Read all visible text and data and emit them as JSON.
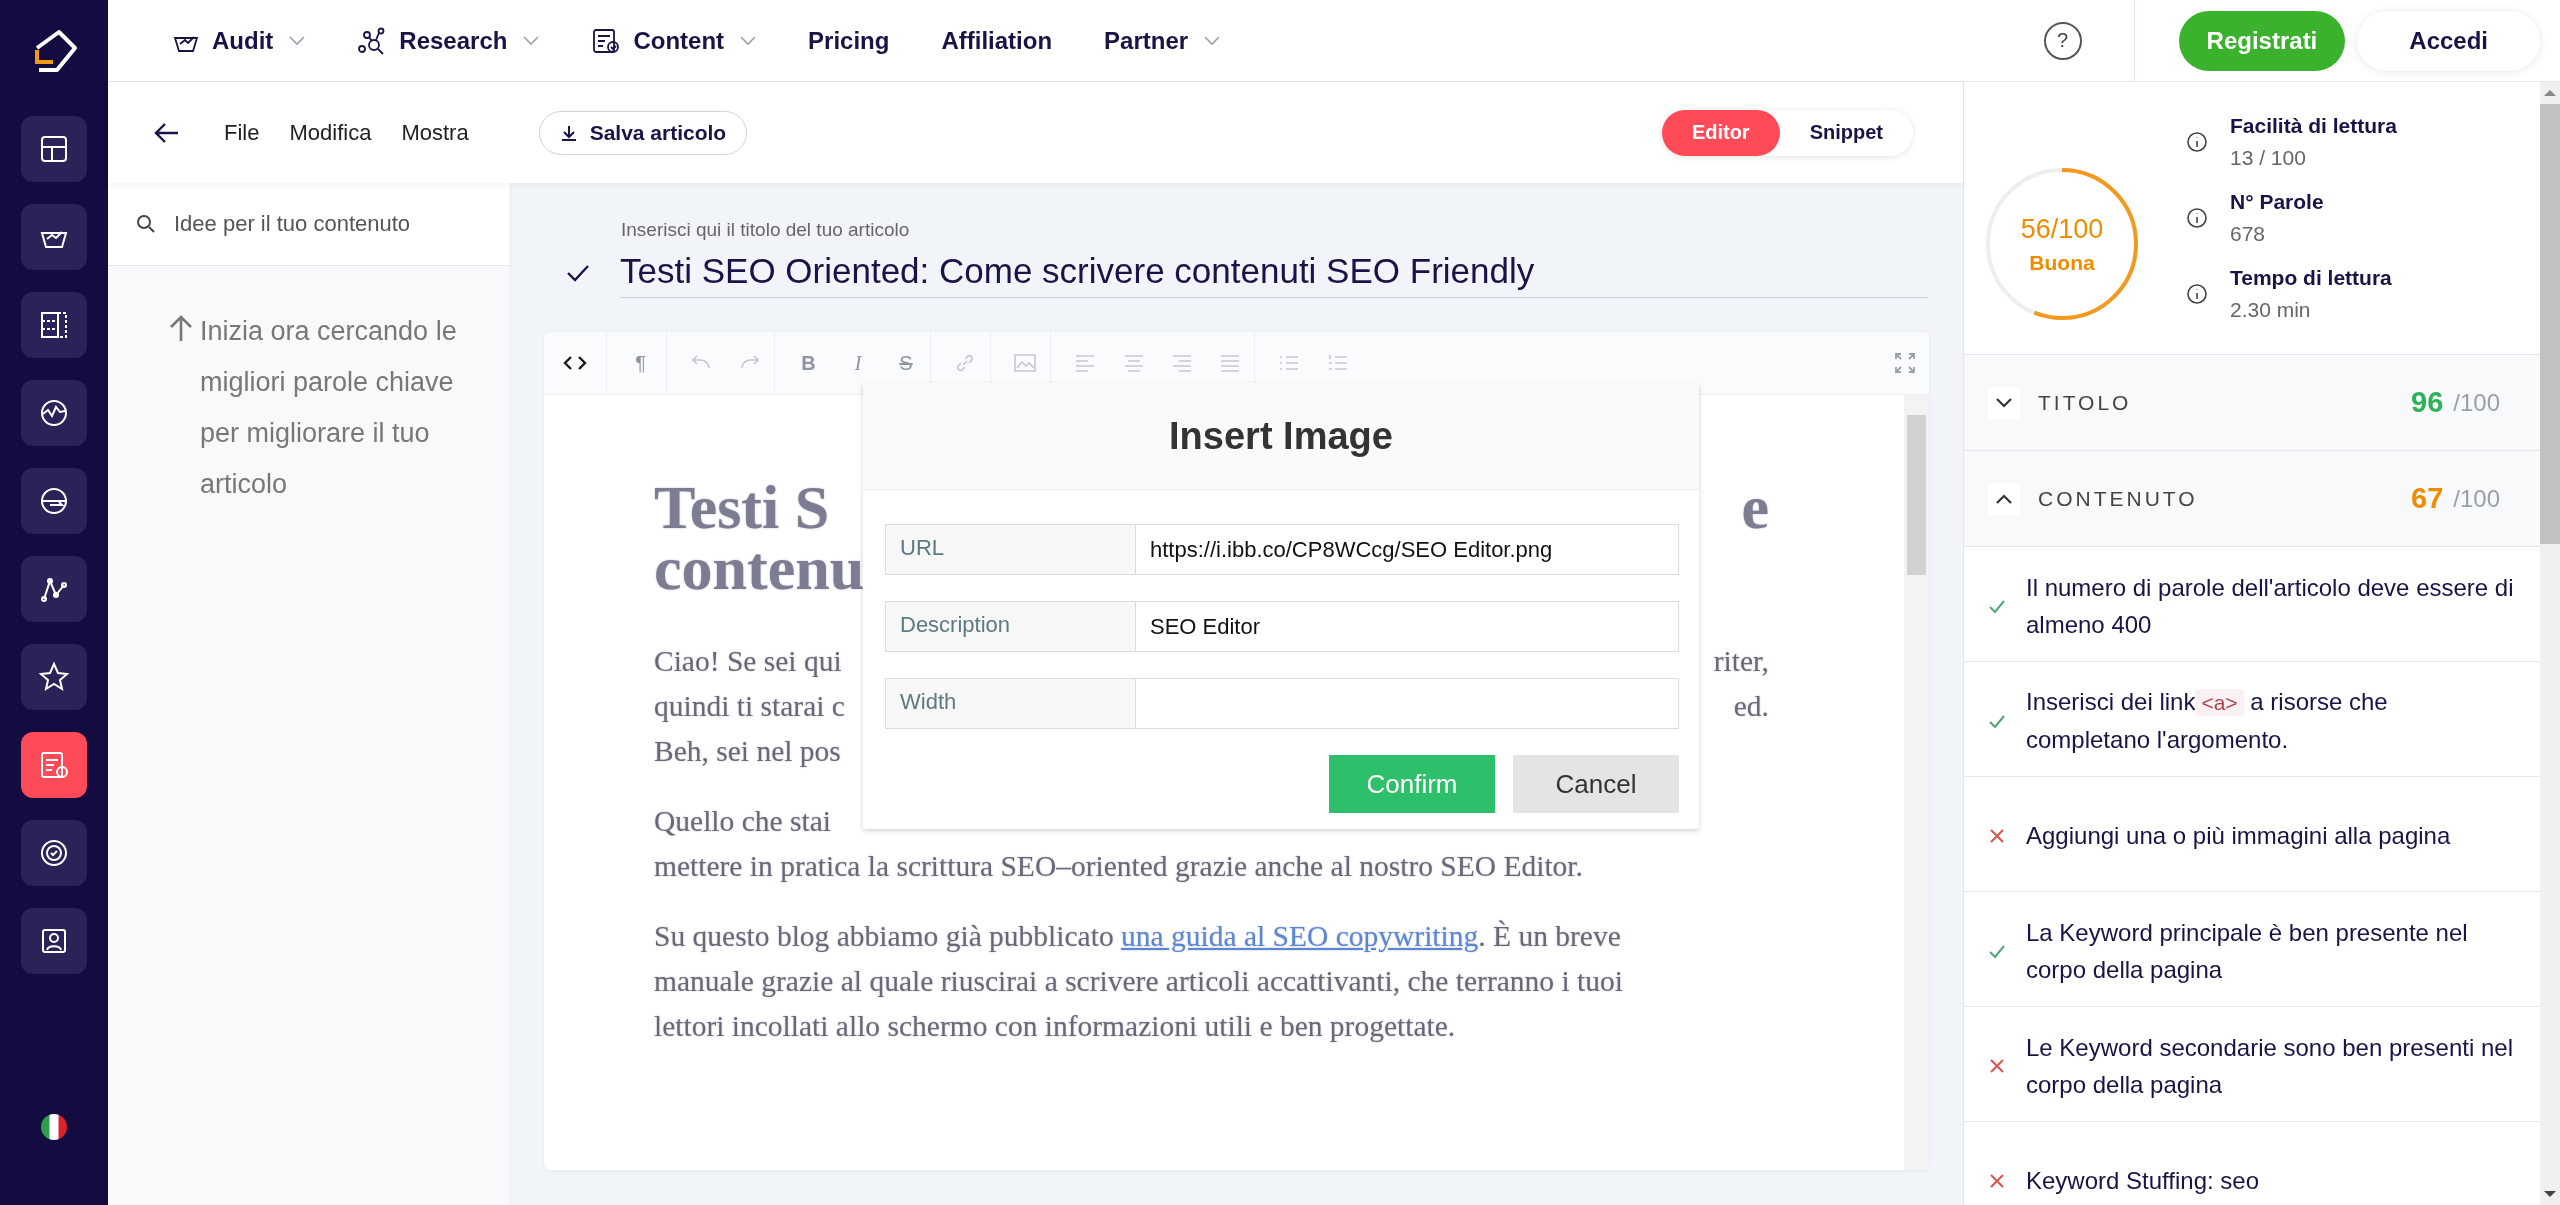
{
  "rail": {
    "items": [
      {
        "selected": false
      },
      {
        "selected": false
      },
      {
        "selected": false
      },
      {
        "selected": false
      },
      {
        "selected": false
      },
      {
        "selected": false
      },
      {
        "selected": false
      },
      {
        "selected": true
      },
      {
        "selected": false
      },
      {
        "selected": false
      }
    ]
  },
  "nav": {
    "items": [
      {
        "label": "Audit",
        "kind": "audit",
        "dropdown": true
      },
      {
        "label": "Research",
        "kind": "research",
        "dropdown": true
      },
      {
        "label": "Content",
        "kind": "content",
        "dropdown": true
      },
      {
        "label": "Pricing",
        "kind": "plain",
        "dropdown": false
      },
      {
        "label": "Affiliation",
        "kind": "plain",
        "dropdown": false
      },
      {
        "label": "Partner",
        "kind": "plain",
        "dropdown": true
      }
    ],
    "help": "?",
    "register": "Registrati",
    "login": "Accedi"
  },
  "toolbar": {
    "menus": [
      "File",
      "Modifica",
      "Mostra"
    ],
    "save": "Salva articolo",
    "views": [
      {
        "label": "Editor",
        "selected": true
      },
      {
        "label": "Snippet",
        "selected": false
      }
    ]
  },
  "ideas": {
    "placeholder": "Idee per il tuo contenuto",
    "hint": "Inizia ora cercando le migliori parole chiave per migliorare il tuo articolo"
  },
  "article": {
    "title_label": "Inserisci qui il titolo del tuo articolo",
    "title": "Testi SEO Oriented: Come scrivere contenuti SEO Friendly",
    "title_confirmed": true
  },
  "editor": {
    "tools": [
      {
        "kind": "code",
        "disabled": false
      },
      {
        "kind": "paragraph",
        "glyph": "¶",
        "disabled": true
      },
      {
        "kind": "undo",
        "disabled": true
      },
      {
        "kind": "redo",
        "disabled": true
      },
      {
        "kind": "bold",
        "glyph": "B",
        "disabled": true
      },
      {
        "kind": "italic",
        "glyph": "I",
        "disabled": true
      },
      {
        "kind": "strike",
        "glyph": "S",
        "disabled": true
      },
      {
        "kind": "link",
        "disabled": true
      },
      {
        "kind": "image",
        "disabled": true
      },
      {
        "kind": "align-left",
        "disabled": true
      },
      {
        "kind": "align-center",
        "disabled": true
      },
      {
        "kind": "align-right",
        "disabled": true
      },
      {
        "kind": "justify",
        "disabled": true
      },
      {
        "kind": "bullets",
        "disabled": true
      },
      {
        "kind": "numbers",
        "disabled": true
      }
    ],
    "blocks": [
      {
        "kind": "heading",
        "lines": [
          {
            "left": "Testi S",
            "right": "e"
          },
          {
            "left": "contenu"
          }
        ]
      },
      {
        "kind": "text",
        "lines": [
          {
            "left": "Ciao! Se sei qui",
            "right": "riter,"
          },
          {
            "left": "quindi ti starai c",
            "right": "ed."
          },
          {
            "left": "Beh, sei nel pos"
          }
        ]
      },
      {
        "kind": "text",
        "lines": [
          {
            "left": "Quello che stai"
          },
          {
            "left": "mettere in pratica la scrittura SEO–oriented grazie anche al nostro SEO Editor."
          }
        ]
      },
      {
        "kind": "link_text",
        "before": "Su questo blog abbiamo già pubblicato",
        "link": "una guida al SEO copywriting",
        "after": ". È un breve manuale grazie al quale riuscirai a scrivere articoli accattivanti, che terranno i tuoi lettori incollati allo schermo con informazioni utili e ben progettate."
      }
    ]
  },
  "dialog": {
    "title": "Insert Image",
    "fields": [
      {
        "label": "URL",
        "value": "https://i.ibb.co/CP8WCcg/SEO Editor.png"
      },
      {
        "label": "Description",
        "value": "SEO Editor"
      },
      {
        "label": "Width"
      }
    ],
    "confirm": "Confirm",
    "cancel": "Cancel"
  },
  "score": {
    "value": "56/100",
    "rating": "Buona",
    "level": 0.56
  },
  "stats": [
    {
      "label": "Facilità di lettura",
      "value": "13 / 100"
    },
    {
      "label": "N° Parole",
      "value": "678"
    },
    {
      "label": "Tempo di lettura",
      "value": "2.30 min"
    }
  ],
  "sections": [
    {
      "name": "TITOLO",
      "score": "96",
      "max": "/100",
      "color": "#2eb35a",
      "expanded": false
    },
    {
      "name": "CONTENUTO",
      "score": "67",
      "max": "/100",
      "color": "#f08c00",
      "expanded": true
    }
  ],
  "checks": [
    {
      "passed": true,
      "text": "Il numero di parole dell'articolo deve essere di almeno 400"
    },
    {
      "passed": true,
      "text": "Inserisci dei link",
      "code": "<a>",
      "after": "a risorse che completano l'argomento."
    },
    {
      "passed": false,
      "text": "Aggiungi una o più immagini alla pagina"
    },
    {
      "passed": true,
      "text": "La Keyword principale è ben presente nel corpo della pagina"
    },
    {
      "passed": false,
      "text": "Le Keyword secondarie sono ben presenti nel corpo della pagina"
    },
    {
      "passed": false,
      "text": "Keyword Stuffing: seo"
    }
  ]
}
